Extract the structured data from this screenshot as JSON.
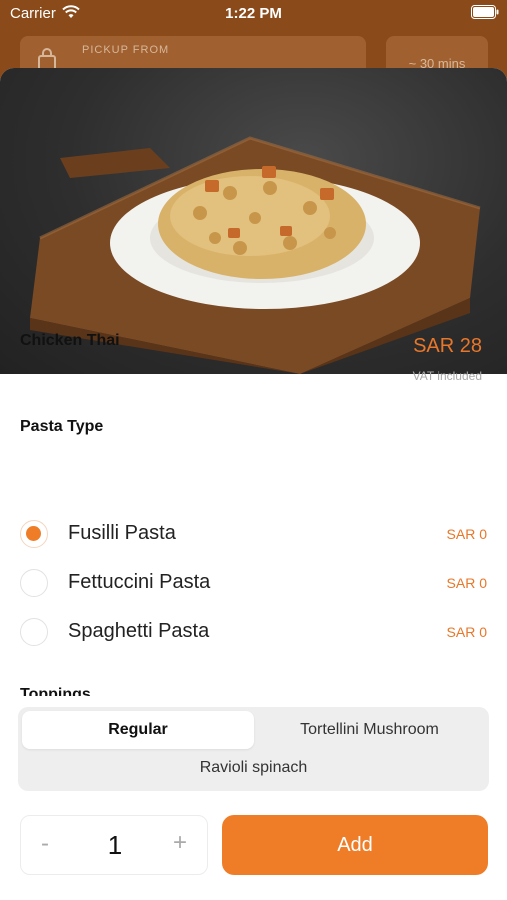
{
  "status_bar": {
    "carrier": "Carrier",
    "time": "1:22 PM",
    "wifi_icon": "wifi-icon",
    "battery_icon": "battery-icon"
  },
  "header": {
    "pickup_label": "PICKUP FROM",
    "pickup_icon": "store-bag-icon",
    "eta": "~ 30 mins"
  },
  "item": {
    "image": "pasta-dish-photo",
    "name": "Chicken Thai",
    "price": "SAR 28",
    "vat_note": "VAT included"
  },
  "pasta_type": {
    "title": "Pasta Type",
    "options": [
      {
        "label": "Fusilli Pasta",
        "price": "SAR 0",
        "selected": true
      },
      {
        "label": "Fettuccini Pasta",
        "price": "SAR 0",
        "selected": false
      },
      {
        "label": "Spaghetti Pasta",
        "price": "SAR 0",
        "selected": false
      }
    ]
  },
  "toppings": {
    "title": "Toppings"
  },
  "segment": {
    "options": [
      "Regular",
      "Tortellini Mushroom",
      "Ravioli spinach"
    ],
    "selected": "Regular"
  },
  "footer": {
    "minus": "-",
    "quantity": "1",
    "plus": "+",
    "add_label": "Add"
  },
  "colors": {
    "accent": "#ef7d28",
    "header_bg": "#8a4a1a"
  }
}
